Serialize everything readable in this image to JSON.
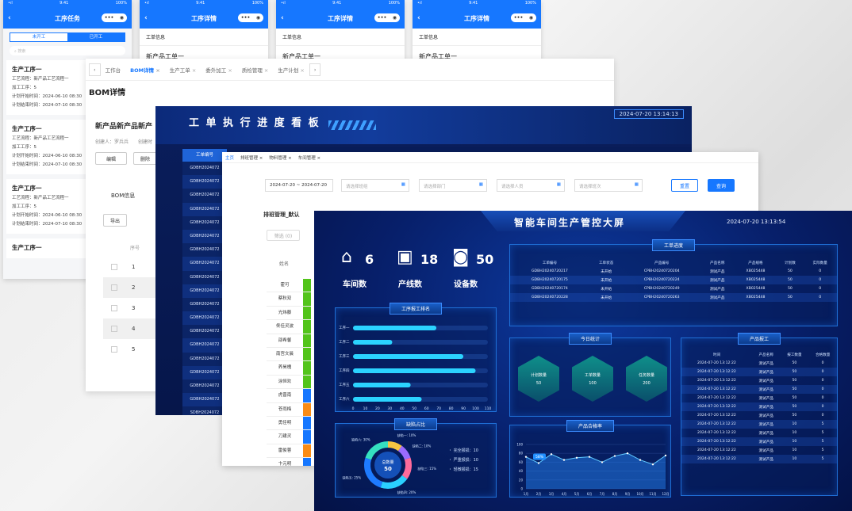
{
  "phones": [
    {
      "time": "9:41",
      "battery": "100%",
      "title": "工序任务",
      "seg": [
        "未开工",
        "已开工"
      ],
      "search": "搜索",
      "cards": [
        {
          "title": "生产工序一",
          "lines": [
            "工艺流程：新产品工艺流程一",
            "加工工序：5",
            "计划开始时间：2024-06-10 08:30",
            "计划结束时间：2024-07-10 08:30"
          ]
        },
        {
          "title": "生产工序一",
          "lines": [
            "工艺流程：新产品工艺流程一",
            "加工工序：5",
            "计划开始时间：2024-06-10 08:30",
            "计划结束时间：2024-07-10 08:30"
          ]
        },
        {
          "title": "生产工序一",
          "lines": [
            "工艺流程：新产品工艺流程一",
            "加工工序：5",
            "计划开始时间：2024-06-10 08:30",
            "计划结束时间：2024-07-10 08:30"
          ]
        },
        {
          "title": "生产工序一",
          "lines": []
        }
      ]
    },
    {
      "time": "9:41",
      "battery": "100%",
      "title": "工序详情",
      "row1": "工单信息",
      "row2": "新产品工单一"
    },
    {
      "time": "9:41",
      "battery": "100%",
      "title": "工序详情",
      "row1": "工单信息",
      "row2": "新产品工单一"
    },
    {
      "time": "9:41",
      "battery": "100%",
      "title": "工序详情",
      "row1": "工单信息",
      "row2": "新产品工单一"
    }
  ],
  "bom": {
    "tabs": [
      "工作台",
      "BOM详情",
      "生产工单",
      "委外加工",
      "质检管理",
      "生产计划"
    ],
    "heading": "BOM详情",
    "product": "新产品新产品新产",
    "creator": "创建人：罗兵兵",
    "created_at": "创建时",
    "btn_edit": "编辑",
    "btn_delete": "删除",
    "subtab": "BOM信息",
    "export": "导出",
    "col_no": "序号",
    "rows": [
      "1",
      "2",
      "3",
      "4",
      "5"
    ]
  },
  "kanban": {
    "title": "工 单 执 行 进 度 看 板",
    "datetime": "2024-07-20 13:14:13",
    "col": "工单编号",
    "rows": [
      "GDBH2024072",
      "GDBH2024072",
      "GDBH2024072",
      "GDBH2024072",
      "GDBH2024072",
      "GDBH2024072",
      "GDBH2024072",
      "GDBH2024072",
      "GDBH2024072",
      "GDBH2024072",
      "GDBH2024072",
      "GDBH2024072",
      "GDBH2024072",
      "GDBH2024072",
      "GDBH2024072",
      "GDBH2024072",
      "GDBH2024072",
      "GDBH2024072",
      "SDBH2024072",
      "GDBH2024072"
    ]
  },
  "sched": {
    "tabs": [
      "主页",
      "排班管理",
      "物料管理",
      "车间管理"
    ],
    "daterange": "2024-07-20 ~ 2024-07-20",
    "ph": [
      "请选择班组",
      "请选择部门",
      "请选择人员",
      "请选择班次"
    ],
    "reset": "重置",
    "query": "查询",
    "section": "排班管理_默认",
    "chip": "筛选 (0)",
    "col_name": "姓名",
    "names": [
      "霍可",
      "蔡秋双",
      "光炜藤",
      "佟佳灵波",
      "邵希馨",
      "南宫文晨",
      "养昊槐",
      "涂恒欢",
      "虎晋南",
      "苍雨梅",
      "勇佳明",
      "刀建灵",
      "雷俊蓉",
      "卞元明"
    ]
  },
  "screen": {
    "title": "智能车间生产管控大屏",
    "datetime": "2024-07-20 13:13:54",
    "stats": [
      {
        "label": "车间数",
        "value": "6",
        "icon": "house-icon"
      },
      {
        "label": "产线数",
        "value": "18",
        "icon": "factory-icon"
      },
      {
        "label": "设备数",
        "value": "50",
        "icon": "device-icon"
      }
    ],
    "progress": {
      "title": "工单进度",
      "headers": [
        "工单编号",
        "工单状态",
        "产品编号",
        "产品名称",
        "产品规格",
        "计划数",
        "实际数量"
      ],
      "rows": [
        [
          "GDBH20240720217",
          "未开始",
          "CPBH20240720204",
          "测试产品",
          "XB025448",
          "50",
          "0"
        ],
        [
          "GDBH20240720175",
          "未开始",
          "CPBH20240720224",
          "测试产品",
          "XB025448",
          "50",
          "0"
        ],
        [
          "GDBH20240720174",
          "未开始",
          "CPBH20240720249",
          "测试产品",
          "XB025448",
          "50",
          "0"
        ],
        [
          "GDBH20240720228",
          "未开始",
          "CPBH20240720263",
          "测试产品",
          "XB025448",
          "50",
          "0"
        ]
      ]
    },
    "rank": {
      "title": "工序报工排名",
      "labels": [
        "工序一",
        "工序二",
        "工序三",
        "工序四",
        "工序五",
        "工序六"
      ],
      "values": [
        68,
        32,
        90,
        100,
        47,
        56
      ],
      "ticks": [
        "0",
        "10",
        "20",
        "30",
        "40",
        "50",
        "60",
        "70",
        "80",
        "90",
        "100",
        "110"
      ]
    },
    "today": {
      "title": "今日统计",
      "items": [
        {
          "label": "计划数量",
          "value": "50"
        },
        {
          "label": "工单数量",
          "value": "100"
        },
        {
          "label": "任务数量",
          "value": "200"
        }
      ]
    },
    "report": {
      "title": "产品报工",
      "headers": [
        "时间",
        "产品名称",
        "报工数量",
        "合格数量"
      ],
      "rows": [
        [
          "2024-07-20 13:12:22",
          "测试产品",
          "50",
          "0"
        ],
        [
          "2024-07-20 13:12:22",
          "测试产品",
          "50",
          "0"
        ],
        [
          "2024-07-20 13:12:22",
          "测试产品",
          "50",
          "0"
        ],
        [
          "2024-07-20 13:12:22",
          "测试产品",
          "50",
          "0"
        ],
        [
          "2024-07-20 13:12:22",
          "测试产品",
          "50",
          "0"
        ],
        [
          "2024-07-20 13:12:22",
          "测试产品",
          "50",
          "0"
        ],
        [
          "2024-07-20 13:12:22",
          "测试产品",
          "50",
          "0"
        ],
        [
          "2024-07-20 13:12:22",
          "测试产品",
          "10",
          "5"
        ],
        [
          "2024-07-20 13:12:22",
          "测试产品",
          "10",
          "5"
        ],
        [
          "2024-07-20 13:12:22",
          "测试产品",
          "10",
          "5"
        ],
        [
          "2024-07-20 13:12:22",
          "测试产品",
          "10",
          "5"
        ],
        [
          "2024-07-20 13:12:22",
          "测试产品",
          "10",
          "5"
        ]
      ]
    },
    "defect": {
      "title": "缺陷占比",
      "center_label": "总数量",
      "center_value": "50",
      "slices": [
        {
          "label": "缺陷一: 10%",
          "v": 10,
          "c": "#f5c542"
        },
        {
          "label": "缺陷二: 10%",
          "v": 10,
          "c": "#9b6bff"
        },
        {
          "label": "缺陷三: 15%",
          "v": 15,
          "c": "#ff6b9b"
        },
        {
          "label": "缺陷四: 20%",
          "v": 20,
          "c": "#2ad0ff"
        },
        {
          "label": "缺陷五: 25%",
          "v": 25,
          "c": "#1e7bff"
        },
        {
          "label": "缺陷六: 30%",
          "v": 20,
          "c": "#35e0c0"
        }
      ],
      "legend": [
        "・ 完全报损：10",
        "・ 严重报损：10",
        "・ 轻微报损：15"
      ]
    },
    "yield": {
      "title": "产品合格率",
      "badge": "58%",
      "months": [
        "1月",
        "2月",
        "3月",
        "4月",
        "5月",
        "6月",
        "7月",
        "8月",
        "9月",
        "10月",
        "11月",
        "12月"
      ],
      "values": [
        72,
        58,
        78,
        65,
        70,
        72,
        60,
        74,
        80,
        65,
        55,
        75
      ],
      "yticks": [
        "0",
        "20",
        "40",
        "60",
        "80",
        "100"
      ]
    }
  },
  "chart_data": [
    {
      "type": "bar",
      "title": "工序报工排名",
      "categories": [
        "工序一",
        "工序二",
        "工序三",
        "工序四",
        "工序五",
        "工序六"
      ],
      "values": [
        68,
        32,
        90,
        100,
        47,
        56
      ],
      "xlim": [
        0,
        110
      ]
    },
    {
      "type": "area",
      "title": "产品合格率",
      "categories": [
        "1月",
        "2月",
        "3月",
        "4月",
        "5月",
        "6月",
        "7月",
        "8月",
        "9月",
        "10月",
        "11月",
        "12月"
      ],
      "values": [
        72,
        58,
        78,
        65,
        70,
        72,
        60,
        74,
        80,
        65,
        55,
        75
      ],
      "ylim": [
        0,
        100
      ]
    },
    {
      "type": "pie",
      "title": "缺陷占比",
      "categories": [
        "缺陷一",
        "缺陷二",
        "缺陷三",
        "缺陷四",
        "缺陷五",
        "缺陷六"
      ],
      "values": [
        10,
        10,
        15,
        20,
        25,
        30
      ]
    }
  ]
}
